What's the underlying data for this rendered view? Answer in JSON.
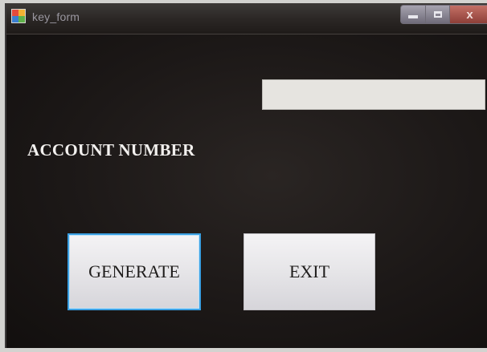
{
  "window": {
    "title": "key_form",
    "controls": {
      "minimize": "minimize",
      "maximize": "maximize",
      "close": "x"
    }
  },
  "form": {
    "key_input": {
      "value": "",
      "placeholder": ""
    },
    "account_label": "ACCOUNT NUMBER",
    "generate_label": "GENERATE",
    "exit_label": "EXIT"
  },
  "colors": {
    "client_background": "#1c1817",
    "close_button": "#b05b52",
    "focus_border": "#3aa0e3"
  }
}
